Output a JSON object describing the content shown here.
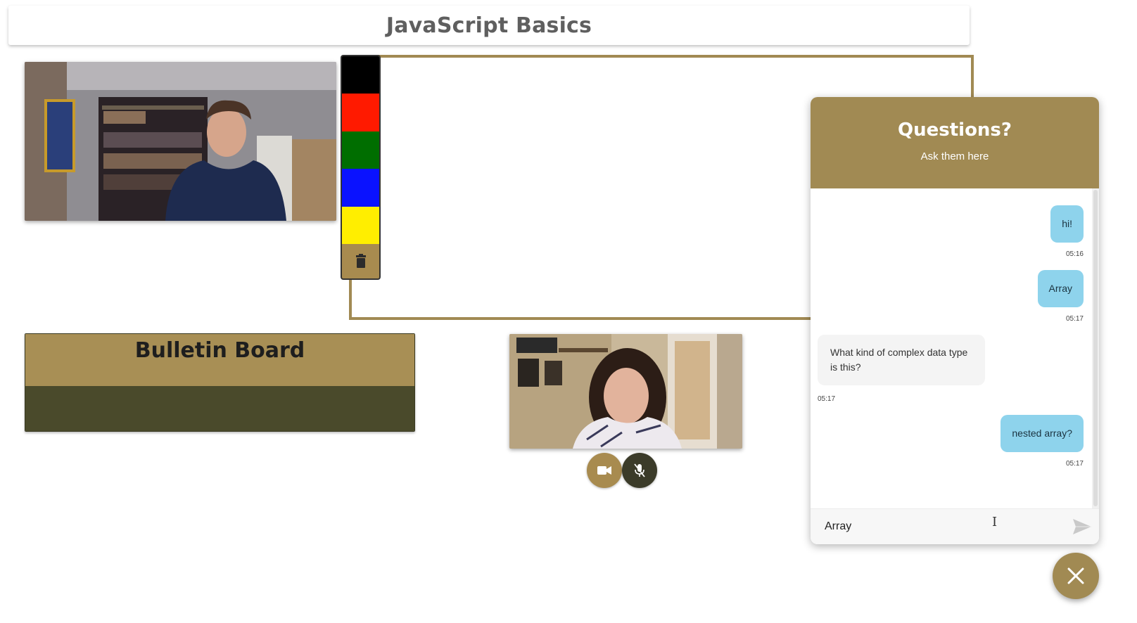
{
  "header": {
    "title": "JavaScript Basics"
  },
  "palette": {
    "colors": [
      "#000000",
      "#ff1a00",
      "#006e00",
      "#0a12ff",
      "#ffee00"
    ],
    "accent": "#a88b4f"
  },
  "bulletin": {
    "title": "Bulletin Board"
  },
  "chat": {
    "title": "Questions?",
    "subtitle": "Ask them here",
    "messages": [
      {
        "from": "me",
        "text": "hi!",
        "time": "05:16"
      },
      {
        "from": "me",
        "text": "Array",
        "time": "05:17"
      },
      {
        "from": "other",
        "text": "What kind of complex data type is this?",
        "time": "05:17"
      },
      {
        "from": "me",
        "text": "nested array?",
        "time": "05:17"
      }
    ],
    "input_value": "Array"
  },
  "colors": {
    "brand": "#a18a53",
    "dark_olive": "#4a4a2b",
    "bubble_out": "#8ed3ec",
    "bubble_in": "#f4f4f4"
  }
}
